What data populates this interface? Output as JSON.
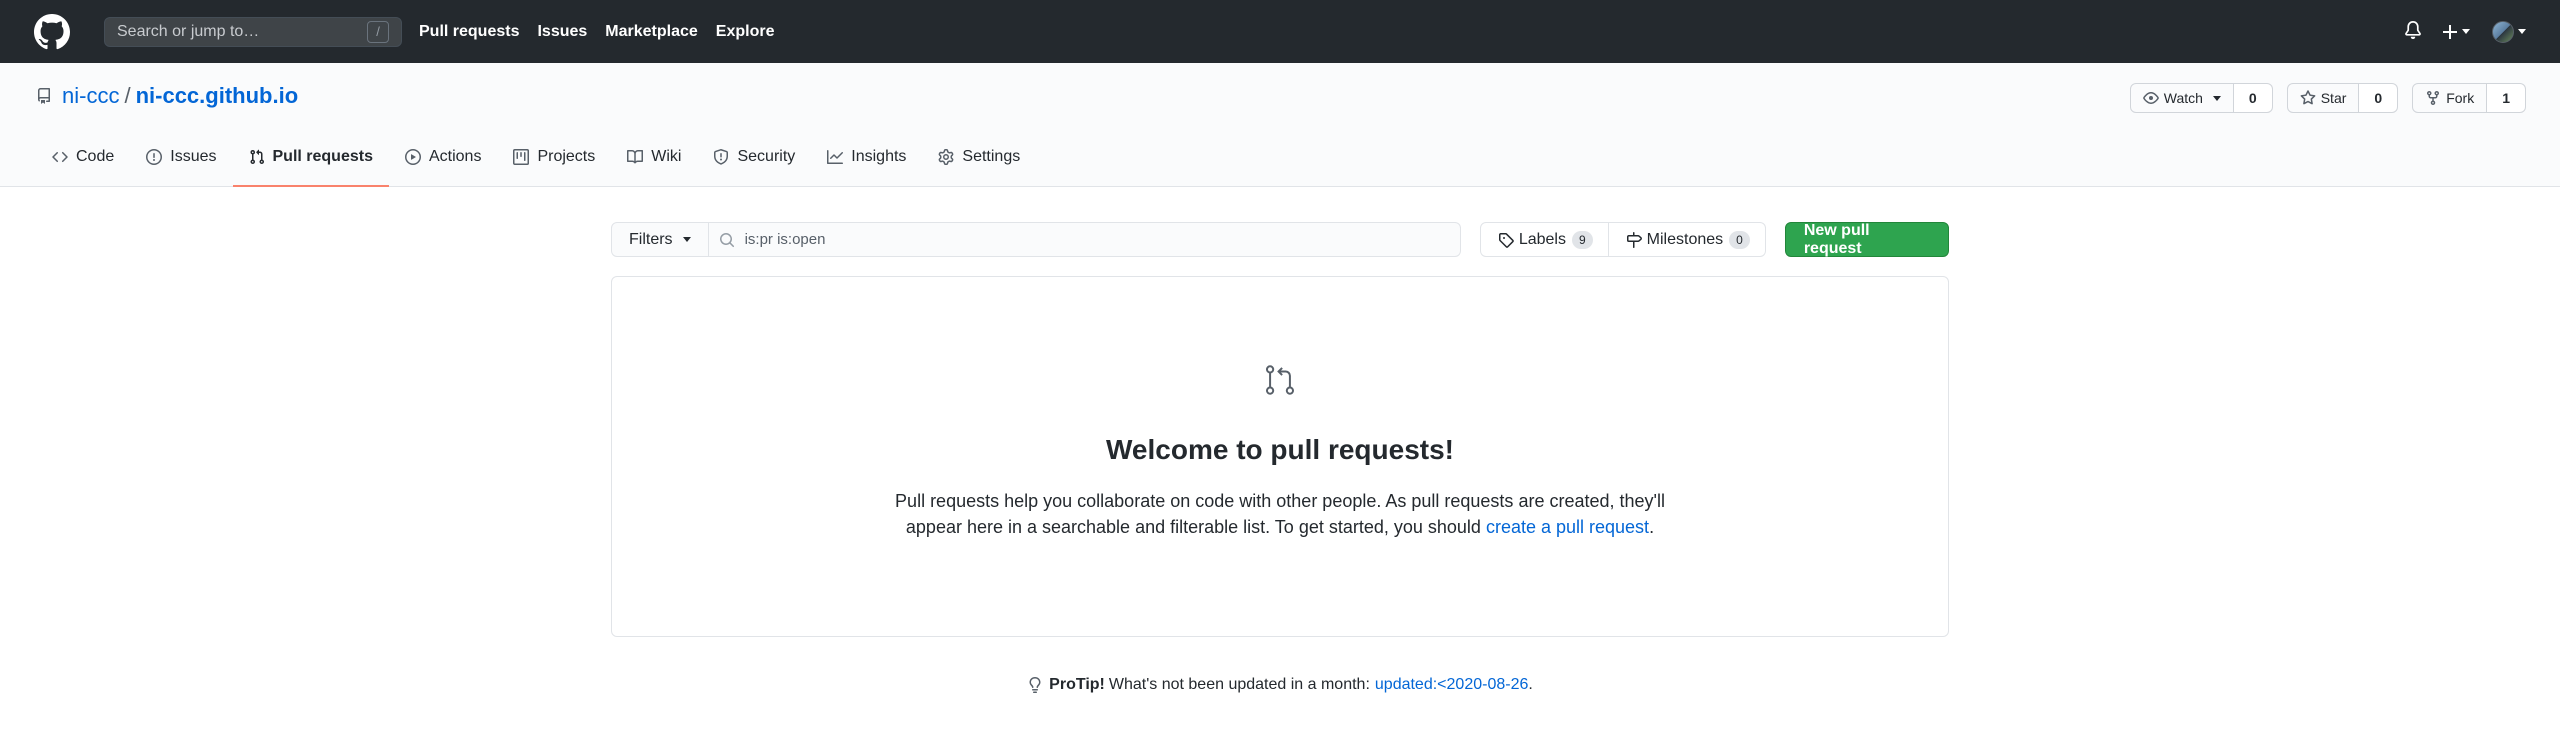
{
  "header": {
    "search_placeholder": "Search or jump to…",
    "search_shortcut": "/",
    "nav": [
      "Pull requests",
      "Issues",
      "Marketplace",
      "Explore"
    ],
    "icons": [
      "github-logo-icon",
      "bell-icon",
      "plus-icon",
      "avatar"
    ]
  },
  "repo": {
    "owner": "ni-ccc",
    "separator": "/",
    "name": "ni-ccc.github.io",
    "watch_label": "Watch",
    "watch_count": "0",
    "star_label": "Star",
    "star_count": "0",
    "fork_label": "Fork",
    "fork_count": "1"
  },
  "tabs": [
    "Code",
    "Issues",
    "Pull requests",
    "Actions",
    "Projects",
    "Wiki",
    "Security",
    "Insights",
    "Settings"
  ],
  "active_tab": "Pull requests",
  "toolbar": {
    "filters_label": "Filters",
    "search_value": "is:pr is:open",
    "labels_label": "Labels",
    "labels_count": "9",
    "milestones_label": "Milestones",
    "milestones_count": "0",
    "new_pr_label": "New pull request"
  },
  "blankslate": {
    "title": "Welcome to pull requests!",
    "text_line1": "Pull requests help you collaborate on code with other people. As pull requests are created, they'll",
    "text_line2_prefix": "appear here in a searchable and filterable list. To get started, you should ",
    "link": "create a pull request",
    "text_line2_suffix": "."
  },
  "protip": {
    "label": "ProTip!",
    "text": "What's not been updated in a month:",
    "link": "updated:<2020-08-26",
    "suffix": "."
  },
  "colors": {
    "header_bg": "#24292e",
    "link": "#0366d6",
    "primary_button": "#2ea44f",
    "active_tab_underline": "#f9826c"
  }
}
